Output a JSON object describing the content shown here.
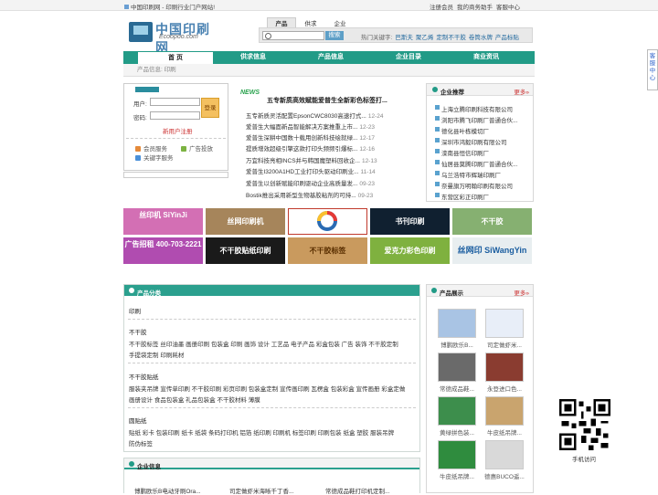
{
  "topbar": {
    "home": "中国印刷网 - 印刷行业门户网站!",
    "links": [
      "注册会员",
      "我的商务助手",
      "客服中心"
    ]
  },
  "logo": {
    "cn": "中国印刷网",
    "en": "Ecoopoo.com"
  },
  "search": {
    "tabs": [
      "产品",
      "供求",
      "企业"
    ],
    "button": "搜索",
    "hot_label": "热门关键字:",
    "hot": [
      "巴斯夫",
      "聚乙烯",
      "定制不干胶",
      "卷筒水牌",
      "产品标贴"
    ]
  },
  "nav": [
    "首 页",
    "供求信息",
    "产品信息",
    "企业目录",
    "商业资讯"
  ],
  "crumb": "产品信息: 印刷",
  "login": {
    "user": "用户:",
    "pass": "密码:",
    "go": "登录",
    "reg": "新用户注册",
    "menu": [
      "会员服务",
      "广告投放",
      "关键字服务"
    ]
  },
  "news": {
    "tag": "NEWS",
    "headline": "五专新质高效赋能爱普生全新彩色标签打...",
    "items": [
      {
        "t": "五专新质灵活配置EpsonCWC8030高速打式...",
        "d": "12-24"
      },
      {
        "t": "爱普生大幅面新品智能解决方案推重上市...",
        "d": "12-23"
      },
      {
        "t": "爱普生深耕中国数十载用创新科技绘就绿...",
        "d": "12-17"
      },
      {
        "t": "提质增效超级引擎这款打印头频频引爆标...",
        "d": "12-16"
      },
      {
        "t": "万宜科技亮相INCS并与韩国魔塑料回收企...",
        "d": "12-13"
      },
      {
        "t": "爱普生I3200A1HD工业打印头驱动印刷业...",
        "d": "11-14"
      },
      {
        "t": "爱普生以创新赋能印刷驱动企业高质量发...",
        "d": "09-23"
      },
      {
        "t": "Bostik推出采用新型生物基胶粘剂的可持...",
        "d": "09-23"
      }
    ]
  },
  "recommend": {
    "title": "企业推荐",
    "more": "更多»",
    "items": [
      "上海立腾印刷科技有限公司",
      "浏阳市腾飞印刷厂普通合伙...",
      "德化县叶栋模切厂",
      "深圳市鸿毅印刷有限公司",
      "滦南县恒信印刷厂",
      "仙居县莫腾印刷厂普通合伙...",
      "乌兰浩特市辉瑞印刷厂",
      "奈曼旗万明翰印刷有限公司",
      "东营区彩正印刷厂"
    ]
  },
  "ads": [
    [
      "丝印机 SiYinJi",
      "丝网印刷机",
      "",
      "书刊印刷",
      "不干胶"
    ],
    [
      "广告招租 400-703-2221",
      "不干胶贴纸印刷",
      "不干胶标签",
      "爱克力彩色印刷",
      "丝网印 SiWangYin"
    ]
  ],
  "categories": {
    "title": "产品分类",
    "groups": [
      {
        "name": "印刷",
        "items": []
      },
      {
        "name": "不干胶",
        "items": [
          "不干胶标签",
          "丝印油墨",
          "画册印刷",
          "包装盒",
          "印刷",
          "画饰",
          "设计",
          "工艺品",
          "电子产品",
          "彩盒包装",
          "广告",
          "装饰",
          "不干胶定制",
          "手提袋定制",
          "印刷耗材"
        ]
      },
      {
        "name": "不干胶贴纸",
        "items": [
          "服装夹吊牌",
          "宣传单印刷",
          "不干胶印刷",
          "彩页印刷",
          "包装盒定制",
          "宣传画印刷",
          "瓦楞盒",
          "包装彩盒",
          "宣传画册",
          "彩盒定做",
          "画册设计",
          "食品包装盒",
          "礼品包装盒",
          "不干胶材料",
          "薄膜"
        ]
      },
      {
        "name": "圆贴纸",
        "items": [
          "贴纸",
          "彩卡",
          "包装印刷",
          "纸卡",
          "纸袋",
          "条码打印机",
          "铝箔",
          "纸印刷",
          "印刷机",
          "标签印刷",
          "印刷包装",
          "纸盒",
          "塑胶",
          "服装吊牌",
          "防伪标签"
        ]
      }
    ]
  },
  "company": {
    "title": "企业信息",
    "items": [
      "博鹏欧乐B电动牙刷Ora...",
      "司定做虾米海晰千丁香...",
      "常德成品鞋打印机定制..."
    ]
  },
  "products": {
    "title": "产品展示",
    "more": "更多»",
    "items": [
      "博鹏欧乐B...",
      "司定做虾米...",
      "常德成品鞋...",
      "永登进口色...",
      "黄绿拼色装...",
      "牛皮纸吊牌...",
      "牛皮纸吊牌...",
      "德惠BUCO遥..."
    ]
  },
  "service": "客服中心",
  "qr_label": "手机访问"
}
